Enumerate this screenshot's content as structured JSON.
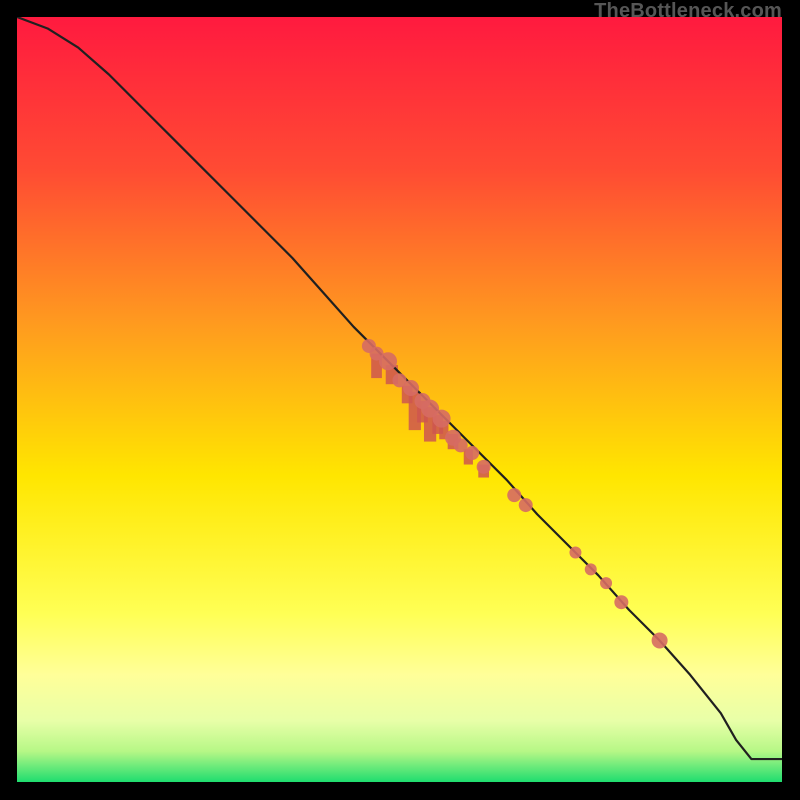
{
  "watermark": "TheBottleneck.com",
  "colors": {
    "border": "#000000",
    "gradient_stops": [
      {
        "offset": 0.0,
        "color": "#ff1a3f"
      },
      {
        "offset": 0.2,
        "color": "#ff4b33"
      },
      {
        "offset": 0.4,
        "color": "#ff9a1f"
      },
      {
        "offset": 0.6,
        "color": "#ffe600"
      },
      {
        "offset": 0.78,
        "color": "#ffff55"
      },
      {
        "offset": 0.86,
        "color": "#ffff99"
      },
      {
        "offset": 0.92,
        "color": "#e8ffa8"
      },
      {
        "offset": 0.96,
        "color": "#b6f786"
      },
      {
        "offset": 1.0,
        "color": "#1fdd6f"
      }
    ],
    "curve": "#202020",
    "spike": "#ce564f",
    "point": "#d66b63"
  },
  "chart_data": {
    "type": "line",
    "title": "",
    "xlabel": "",
    "ylabel": "",
    "xlim": [
      0,
      100
    ],
    "ylim": [
      0,
      100
    ],
    "x": [
      0,
      4,
      8,
      12,
      16,
      20,
      24,
      28,
      32,
      36,
      40,
      44,
      48,
      52,
      56,
      60,
      64,
      68,
      72,
      76,
      80,
      84,
      88,
      92,
      94,
      96,
      100
    ],
    "y": [
      100,
      98.5,
      96,
      92.5,
      88.5,
      84.5,
      80.5,
      76.5,
      72.5,
      68.5,
      64,
      59.5,
      55.5,
      51.5,
      47.5,
      43.5,
      39.5,
      35,
      31,
      27,
      22.5,
      18.5,
      14,
      9,
      5.5,
      3,
      3
    ],
    "points": [
      {
        "x": 46.0,
        "y": 57.0,
        "r": 7
      },
      {
        "x": 47.0,
        "y": 56.0,
        "r": 7
      },
      {
        "x": 48.5,
        "y": 55.0,
        "r": 9
      },
      {
        "x": 50.0,
        "y": 52.5,
        "r": 7
      },
      {
        "x": 51.5,
        "y": 51.5,
        "r": 8
      },
      {
        "x": 53.0,
        "y": 49.8,
        "r": 8
      },
      {
        "x": 54.0,
        "y": 48.8,
        "r": 9
      },
      {
        "x": 55.5,
        "y": 47.5,
        "r": 9
      },
      {
        "x": 57.0,
        "y": 45.0,
        "r": 8
      },
      {
        "x": 58.0,
        "y": 44.0,
        "r": 7
      },
      {
        "x": 59.5,
        "y": 43.0,
        "r": 7
      },
      {
        "x": 61.0,
        "y": 41.2,
        "r": 7
      },
      {
        "x": 65.0,
        "y": 37.5,
        "r": 7
      },
      {
        "x": 66.5,
        "y": 36.2,
        "r": 7
      },
      {
        "x": 73.0,
        "y": 30.0,
        "r": 6
      },
      {
        "x": 75.0,
        "y": 27.8,
        "r": 6
      },
      {
        "x": 77.0,
        "y": 26.0,
        "r": 6
      },
      {
        "x": 79.0,
        "y": 23.5,
        "r": 7
      },
      {
        "x": 84.0,
        "y": 18.5,
        "r": 8
      }
    ],
    "spikes": [
      {
        "x": 47.0,
        "top": 56.0,
        "bottom": 52.8,
        "w": 1.4
      },
      {
        "x": 49.0,
        "top": 54.5,
        "bottom": 52.0,
        "w": 1.6
      },
      {
        "x": 51.0,
        "top": 51.8,
        "bottom": 49.5,
        "w": 1.4
      },
      {
        "x": 52.0,
        "top": 51.0,
        "bottom": 46.0,
        "w": 1.6
      },
      {
        "x": 53.0,
        "top": 49.8,
        "bottom": 47.0,
        "w": 1.4
      },
      {
        "x": 54.0,
        "top": 49.0,
        "bottom": 44.5,
        "w": 1.6
      },
      {
        "x": 55.0,
        "top": 48.0,
        "bottom": 45.5,
        "w": 1.4
      },
      {
        "x": 55.8,
        "top": 47.2,
        "bottom": 44.8,
        "w": 1.2
      },
      {
        "x": 57.0,
        "top": 45.5,
        "bottom": 43.5,
        "w": 1.4
      },
      {
        "x": 59.0,
        "top": 43.5,
        "bottom": 41.5,
        "w": 1.2
      },
      {
        "x": 61.0,
        "top": 41.5,
        "bottom": 39.8,
        "w": 1.4
      }
    ]
  }
}
